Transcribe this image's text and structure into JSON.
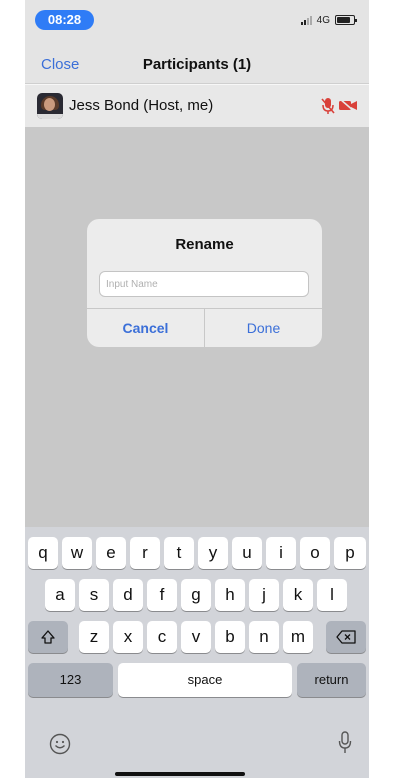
{
  "status_bar": {
    "time": "08:28",
    "network": "4G",
    "signal_icon": "signal-bars-icon",
    "battery_icon": "battery-icon"
  },
  "nav": {
    "close_label": "Close",
    "title": "Participants (1)"
  },
  "participant": {
    "name": "Jess Bond (Host, me)",
    "mic_status_icon": "mic-muted-icon",
    "video_status_icon": "video-off-icon",
    "status_color": "#d9413a"
  },
  "dialog": {
    "title": "Rename",
    "input_value": "",
    "input_placeholder": "Input Name",
    "cancel_label": "Cancel",
    "done_label": "Done",
    "accent_color": "#3b6fd8"
  },
  "keyboard": {
    "row1": [
      "q",
      "w",
      "e",
      "r",
      "t",
      "y",
      "u",
      "i",
      "o",
      "p"
    ],
    "row2": [
      "a",
      "s",
      "d",
      "f",
      "g",
      "h",
      "j",
      "k",
      "l"
    ],
    "row3": [
      "z",
      "x",
      "c",
      "v",
      "b",
      "n",
      "m"
    ],
    "numbers_label": "123",
    "space_label": "space",
    "return_label": "return",
    "shift_icon": "shift-icon",
    "backspace_icon": "backspace-icon",
    "emoji_icon": "emoji-icon",
    "mic_icon": "microphone-icon"
  }
}
